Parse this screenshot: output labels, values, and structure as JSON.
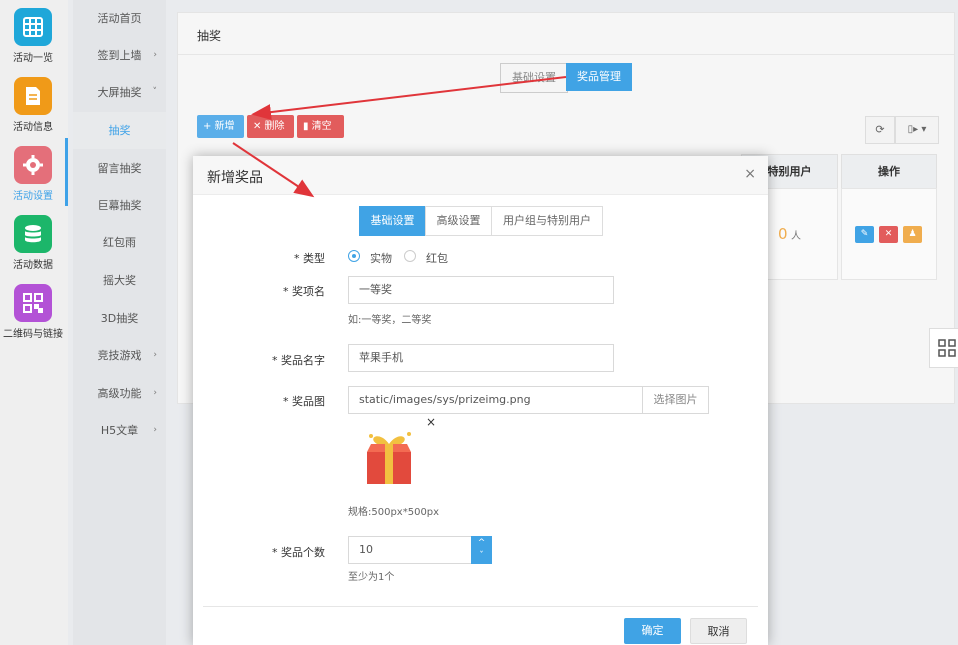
{
  "rail": {
    "items": [
      {
        "label": "活动一览",
        "icon": "grid-icon",
        "color": "#1fa7d9"
      },
      {
        "label": "活动信息",
        "icon": "document-icon",
        "color": "#f09a18"
      },
      {
        "label": "活动设置",
        "icon": "gear-icon",
        "color": "#e46f7a"
      },
      {
        "label": "活动数据",
        "icon": "database-icon",
        "color": "#1cb66a"
      },
      {
        "label": "二维码与链接",
        "icon": "qrcode-icon",
        "color": "#b352d6"
      }
    ]
  },
  "subnav": {
    "items": [
      {
        "label": "活动首页",
        "arrow": ""
      },
      {
        "label": "签到上墙",
        "arrow": "›"
      },
      {
        "label": "大屏抽奖",
        "arrow": "˅"
      },
      {
        "label": "抽奖",
        "arrow": ""
      },
      {
        "label": "留言抽奖",
        "arrow": ""
      },
      {
        "label": "巨幕抽奖",
        "arrow": ""
      },
      {
        "label": "红包雨",
        "arrow": ""
      },
      {
        "label": "摇大奖",
        "arrow": ""
      },
      {
        "label": "3D抽奖",
        "arrow": ""
      },
      {
        "label": "竞技游戏",
        "arrow": "›"
      },
      {
        "label": "高级功能",
        "arrow": "›"
      },
      {
        "label": "H5文章",
        "arrow": "›"
      }
    ]
  },
  "panel": {
    "title": "抽奖",
    "tabs": [
      "基础设置",
      "奖品管理"
    ],
    "toolbar": {
      "add": "+ 新增",
      "delete": "✕ 删除",
      "clear": "▮ 清空"
    },
    "table": {
      "headers": [
        "特别用户",
        "操作"
      ],
      "row": {
        "special_count": "0",
        "special_unit": "人"
      }
    }
  },
  "modal": {
    "title": "新增奖品",
    "close": "×",
    "tabs": [
      "基础设置",
      "高级设置",
      "用户组与特别用户"
    ],
    "fields": {
      "type": {
        "label": "* 类型",
        "options": [
          "实物",
          "红包"
        ],
        "selected": "实物"
      },
      "level": {
        "label": "* 奖项名",
        "value": "一等奖",
        "hint": "如:一等奖，二等奖"
      },
      "name": {
        "label": "* 奖品名字",
        "value": "苹果手机"
      },
      "image": {
        "label": "* 奖品图",
        "value": "static/images/sys/prizeimg.png",
        "pick": "选择图片",
        "remove": "×",
        "spec": "规格:500px*500px"
      },
      "count": {
        "label": "* 奖品个数",
        "value": "10",
        "hint": "至少为1个",
        "up": "^",
        "down": "ˇ"
      }
    },
    "buttons": {
      "ok": "确定",
      "cancel": "取消"
    }
  },
  "colors": {
    "primary": "#40a3e5",
    "danger": "#e25c5c",
    "warning": "#f0ad4e",
    "arrow": "#e0353a"
  }
}
